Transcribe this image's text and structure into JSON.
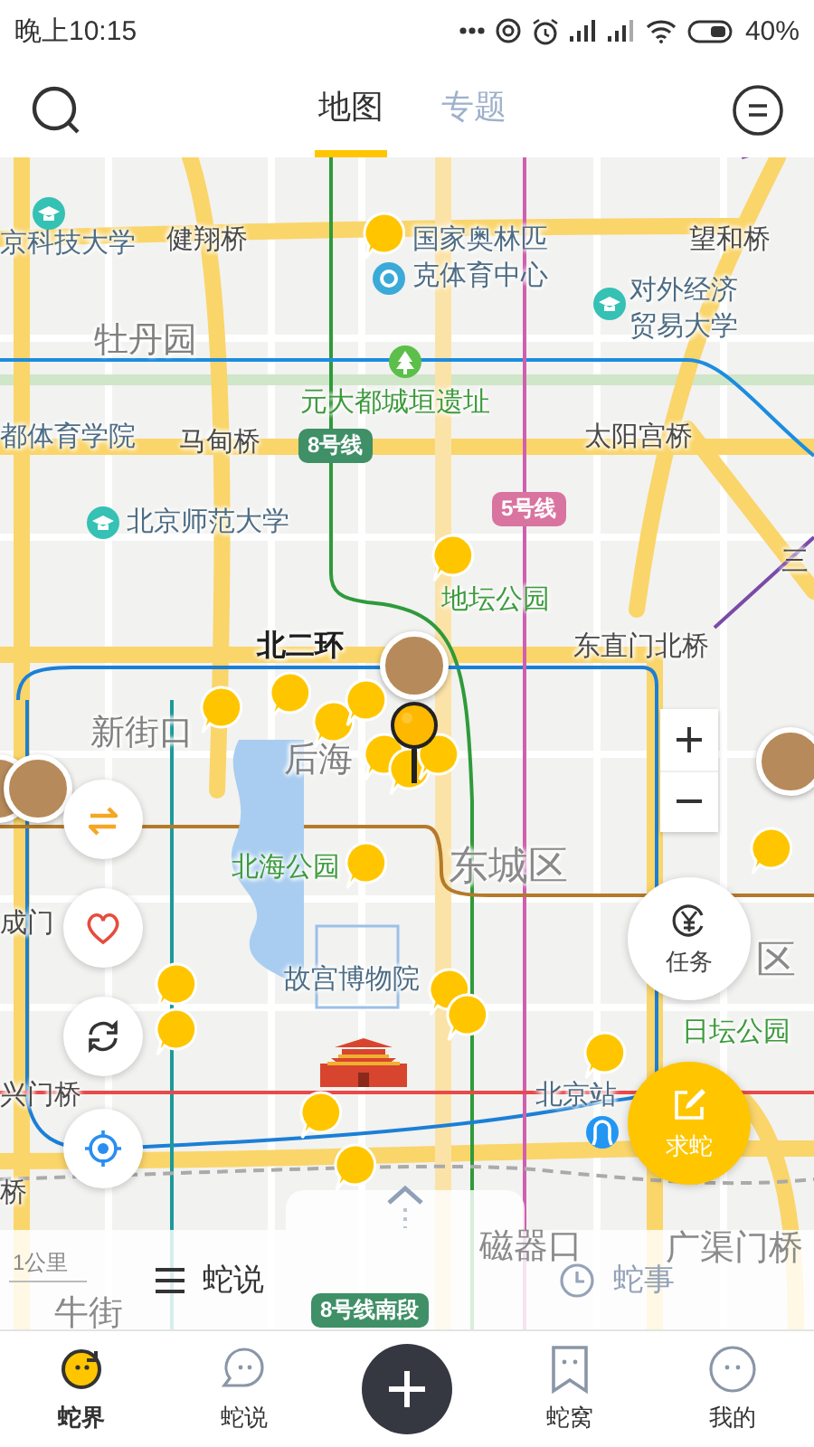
{
  "status_bar": {
    "time": "晚上10:15",
    "battery": "40%"
  },
  "header": {
    "tabs": [
      {
        "label": "地图",
        "selected": true
      },
      {
        "label": "专题",
        "selected": false
      }
    ]
  },
  "map": {
    "labels": [
      {
        "text": "京科技大学",
        "kind": "poi"
      },
      {
        "text": "健翔桥",
        "kind": "place"
      },
      {
        "text": "国家奥林匹克体育中心",
        "kind": "poi"
      },
      {
        "text": "望和桥",
        "kind": "place"
      },
      {
        "text": "对外经济贸易大学",
        "kind": "poi"
      },
      {
        "text": "牡丹园",
        "kind": "faint"
      },
      {
        "text": "元大都城垣遗址",
        "kind": "park"
      },
      {
        "text": "都体育学院",
        "kind": "poi"
      },
      {
        "text": "马甸桥",
        "kind": "place"
      },
      {
        "text": "太阳宫桥",
        "kind": "place"
      },
      {
        "text": "北京师范大学",
        "kind": "poi"
      },
      {
        "text": "地坛公园",
        "kind": "park"
      },
      {
        "text": "三",
        "kind": "place"
      },
      {
        "text": "北二环",
        "kind": "road"
      },
      {
        "text": "东直门北桥",
        "kind": "place"
      },
      {
        "text": "新街口",
        "kind": "faint"
      },
      {
        "text": "后海",
        "kind": "faint"
      },
      {
        "text": "北海公园",
        "kind": "park"
      },
      {
        "text": "东城区",
        "kind": "district"
      },
      {
        "text": "成门",
        "kind": "place"
      },
      {
        "text": "故宫博物院",
        "kind": "poi"
      },
      {
        "text": "区",
        "kind": "district"
      },
      {
        "text": "日坛公园",
        "kind": "park"
      },
      {
        "text": "兴门桥",
        "kind": "place"
      },
      {
        "text": "北京站",
        "kind": "poi"
      },
      {
        "text": "桥",
        "kind": "place"
      },
      {
        "text": "磁器口",
        "kind": "faint"
      },
      {
        "text": "广渠门桥",
        "kind": "faint"
      },
      {
        "text": "牛街",
        "kind": "faint"
      }
    ],
    "line_badges": [
      {
        "text": "8号线",
        "color": "#3f8f67"
      },
      {
        "text": "5号线",
        "color": "#d9739f"
      },
      {
        "text": "8号线南段",
        "color": "#3f8f67"
      }
    ],
    "scale": "1公里",
    "task_button": {
      "label": "任务"
    },
    "ask_button": {
      "label": "求蛇"
    }
  },
  "bottom_sheet": {
    "tabs": [
      {
        "label": "蛇说",
        "selected": true
      },
      {
        "label": "蛇事",
        "selected": false
      }
    ]
  },
  "nav": [
    {
      "label": "蛇界",
      "selected": true
    },
    {
      "label": "蛇说",
      "selected": false
    },
    {
      "label": "蛇窝",
      "selected": false
    },
    {
      "label": "我的",
      "selected": false
    }
  ]
}
